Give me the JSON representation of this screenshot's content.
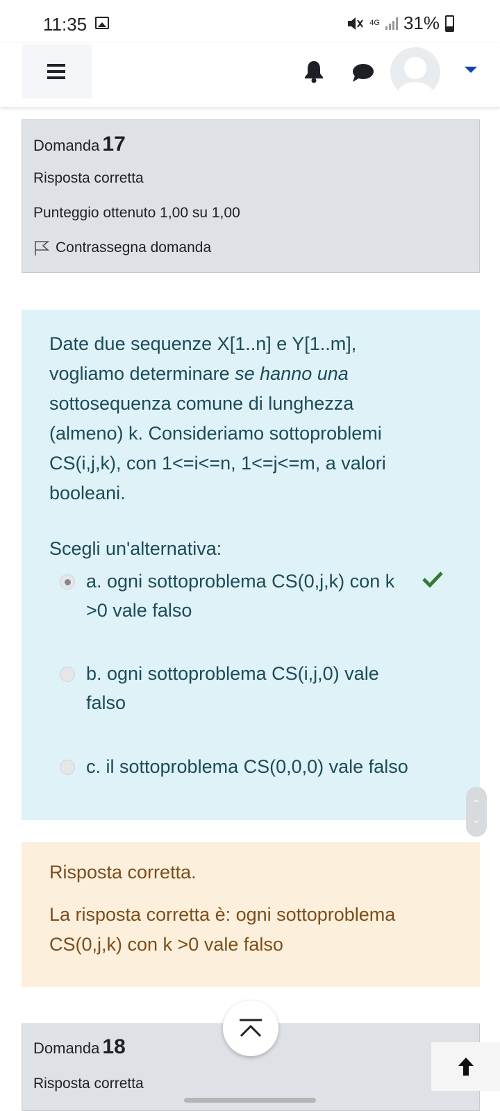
{
  "status_bar": {
    "time": "11:35",
    "network": "4G",
    "battery": "31%"
  },
  "question": {
    "label": "Domanda",
    "number": "17",
    "state": "Risposta corretta",
    "grade": "Punteggio ottenuto 1,00 su 1,00",
    "flag_label": "Contrassegna domanda",
    "text_part1": "Date due sequenze X[1..n] e Y[1..m], vogliamo determinare ",
    "text_italic": "se hanno una",
    "text_part2": " sottosequenza comune di lunghezza (almeno) k. Consideriamo sottoproblemi  CS(i,j,k), con 1<=i<=n, 1<=j<=m, a valori booleani.",
    "prompt": "Scegli un'alternativa:",
    "answers": [
      {
        "label": "a. ogni sottoproblema CS(0,j,k) con k >0 vale falso",
        "checked": true,
        "correct": true
      },
      {
        "label": "b. ogni sottoproblema CS(i,j,0) vale falso",
        "checked": false
      },
      {
        "label": "c. il sottoproblema CS(0,0,0) vale falso",
        "checked": false
      }
    ]
  },
  "feedback": {
    "status": "Risposta corretta.",
    "right_answer": "La risposta corretta è: ogni sottoproblema CS(0,j,k) con k >0 vale falso"
  },
  "next_question": {
    "label": "Domanda",
    "number": "18",
    "state": "Risposta corretta"
  },
  "colors": {
    "content_bg": "#def2f8",
    "feedback_bg": "#fcefdc",
    "info_bg": "#dee2e6",
    "check": "#357a32",
    "caret": "#0f47ad"
  }
}
